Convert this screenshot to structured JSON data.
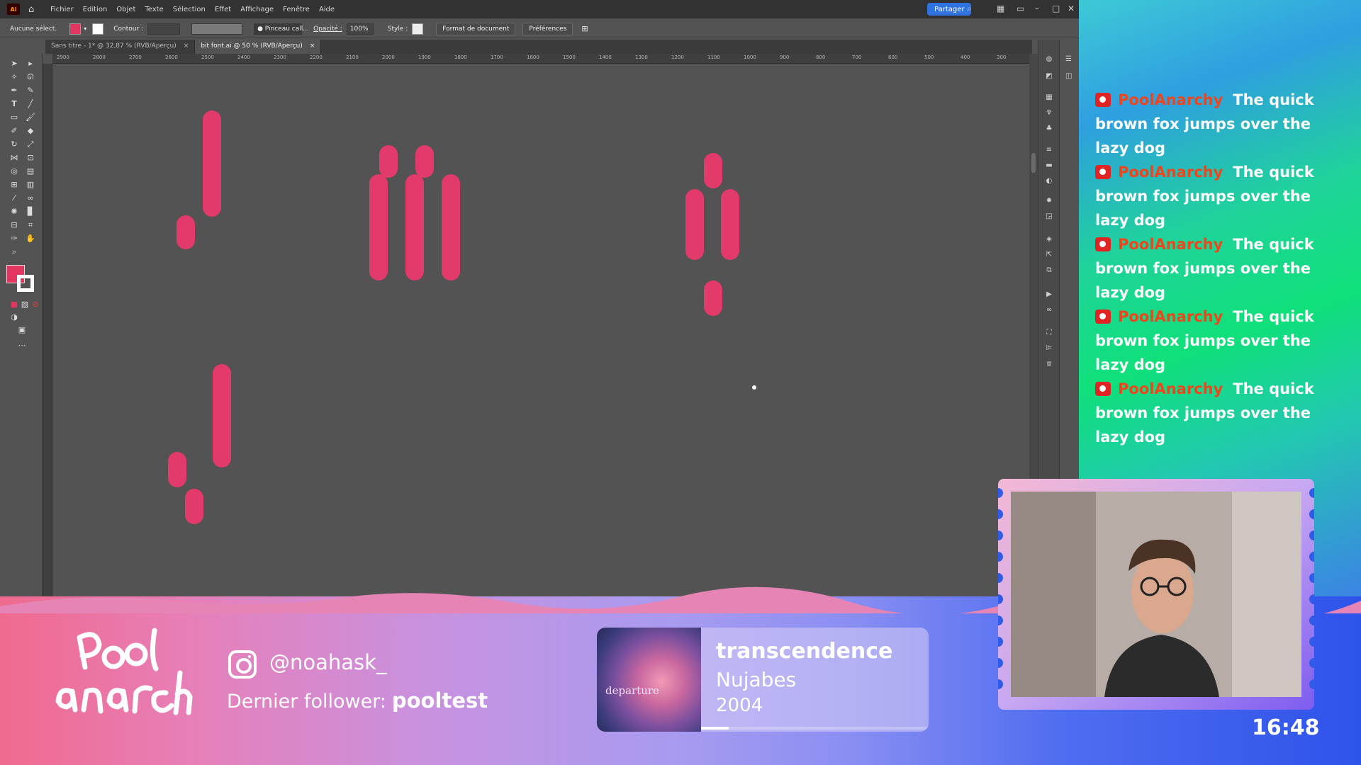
{
  "app": {
    "logo_text": "Ai",
    "menu": [
      "Fichier",
      "Edition",
      "Objet",
      "Texte",
      "Sélection",
      "Effet",
      "Affichage",
      "Fenêtre",
      "Aide"
    ],
    "share_label": "Partager"
  },
  "control_bar": {
    "selection_label": "Aucune sélect.",
    "fill_color": "#e0365f",
    "stroke_label": "Contour :",
    "brush_label": "Pinceau call...",
    "opacity_label": "Opacité :",
    "opacity_value": "100%",
    "style_label": "Style :",
    "doc_format_button": "Format de document",
    "prefs_button": "Préférences"
  },
  "tabs": [
    {
      "label": "Sans titre - 1* @ 32,87 % (RVB/Aperçu)",
      "close": "×",
      "active": false
    },
    {
      "label": "bit font.ai @ 50 % (RVB/Aperçu)",
      "close": "×",
      "active": true
    }
  ],
  "ruler_ticks": [
    "2900",
    "2800",
    "2700",
    "2600",
    "2500",
    "2400",
    "2300",
    "2200",
    "2100",
    "2000",
    "1900",
    "1800",
    "1700",
    "1600",
    "1500",
    "1400",
    "1300",
    "1200",
    "1100",
    "1000",
    "900",
    "800",
    "700",
    "600",
    "500",
    "400",
    "300"
  ],
  "art": {
    "glyph_color": "#e23a6a"
  },
  "chat": {
    "messages": [
      {
        "user": "PoolAnarchy",
        "text": "The quick brown fox jumps over the lazy dog"
      },
      {
        "user": "PoolAnarchy",
        "text": "The quick brown fox jumps over the lazy dog"
      },
      {
        "user": "PoolAnarchy",
        "text": "The quick brown fox jumps over the lazy dog"
      },
      {
        "user": "PoolAnarchy",
        "text": "The quick brown fox jumps over the lazy dog"
      },
      {
        "user": "PoolAnarchy",
        "text": "The quick brown fox jumps over the lazy dog"
      }
    ]
  },
  "overlay": {
    "logo_text": "pool anarchy",
    "instagram_handle": "@noahask_",
    "follower_label": "Dernier follower:",
    "follower_name": "pooltest",
    "now_playing": {
      "title": "transcendence",
      "artist": "Nujabes",
      "year": "2004",
      "cover_text": "departure",
      "progress": 0.12
    },
    "clock": "16:48"
  }
}
